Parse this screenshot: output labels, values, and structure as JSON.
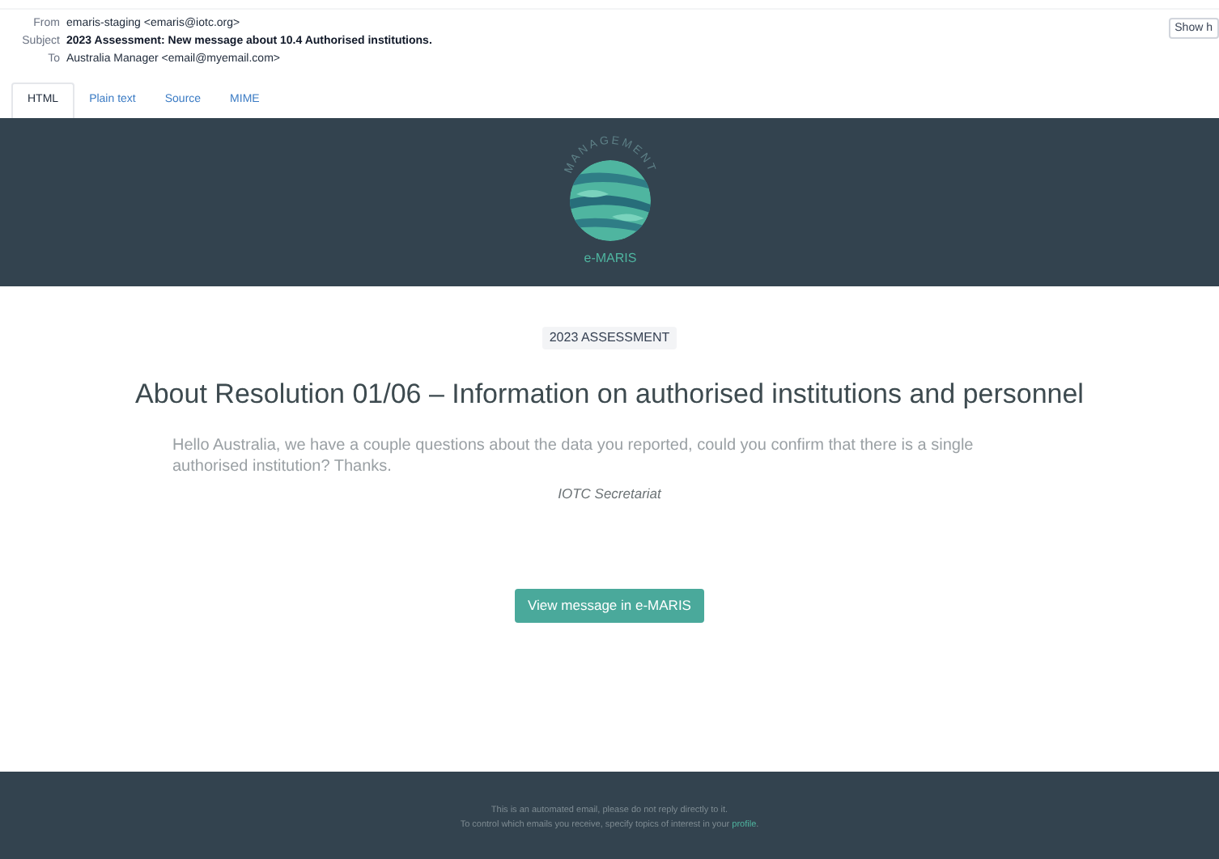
{
  "headers": [
    {
      "label": "From",
      "value": "emaris-staging <emaris@iotc.org>",
      "bold": false
    },
    {
      "label": "Subject",
      "value": "2023 Assessment: New message about 10.4 Authorised institutions.",
      "bold": true
    },
    {
      "label": "To",
      "value": "Australia Manager <email@myemail.com>",
      "bold": false
    }
  ],
  "show_button": "Show h",
  "tabs": [
    {
      "label": "HTML",
      "selected": true
    },
    {
      "label": "Plain text",
      "selected": false
    },
    {
      "label": "Source",
      "selected": false
    },
    {
      "label": "MIME",
      "selected": false
    }
  ],
  "email": {
    "logo": {
      "arc_text": "MANAGEMENT",
      "name": "e-MARIS"
    },
    "badge": "2023 ASSESSMENT",
    "title": "About Resolution 01/06 – Information on authorised institutions and personnel",
    "message": "Hello Australia, we have a couple questions about the data you reported, could you confirm that there is a single authorised institution? Thanks.",
    "signature": "IOTC Secretariat",
    "button": "View message in e-MARIS",
    "footer": {
      "line_1": "This is an automated email, please do not reply directly to it.",
      "line_2_before": "To control which emails you receive, specify topics of interest in your ",
      "line_2_link": "profile",
      "line_2_after": "."
    }
  }
}
